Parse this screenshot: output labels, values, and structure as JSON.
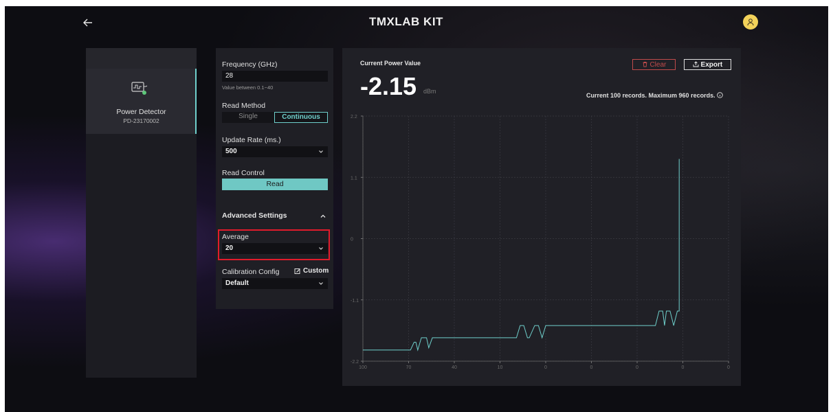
{
  "header": {
    "logo_mark": "T",
    "logo_text": "MXLAB KIT"
  },
  "icons": {
    "back": "arrow-left-icon",
    "avatar": "user-icon",
    "device": "power-detector-icon",
    "chevron": "chevron-down-icon",
    "chevron_up": "chevron-up-icon",
    "edit": "edit-icon",
    "trash": "trash-icon",
    "export": "export-icon",
    "info": "info-icon"
  },
  "colors": {
    "accent": "#6fd0cc",
    "danger": "#c04b4b",
    "avatar": "#f2d25a",
    "highlight": "#e21b2b"
  },
  "device": {
    "name": "Power Detector",
    "id": "PD-23170002",
    "status": "connected"
  },
  "settings": {
    "frequency_label": "Frequency (GHz)",
    "frequency_value": "28",
    "frequency_hint": "Value between 0.1~40",
    "read_method_label": "Read Method",
    "read_method_options": [
      "Single",
      "Continuous"
    ],
    "read_method_selected": "Continuous",
    "update_rate_label": "Update Rate (ms.)",
    "update_rate_value": "500",
    "read_control_label": "Read Control",
    "read_button": "Read",
    "advanced_label": "Advanced Settings",
    "average_label": "Average",
    "average_value": "20",
    "calibration_label": "Calibration Config",
    "custom_label": "Custom",
    "calibration_value": "Default"
  },
  "power": {
    "title": "Current Power Value",
    "value": "-2.15",
    "unit": "dBm",
    "clear_label": "Clear",
    "export_label": "Export",
    "records_text": "Current 100 records. Maximum 960 records."
  },
  "chart_data": {
    "type": "line",
    "y_ticks": [
      "2.2",
      "1.1",
      "0",
      "-1.1",
      "-2.2"
    ],
    "x_ticks": [
      "100",
      "70",
      "40",
      "10",
      "0",
      "0",
      "0",
      "0",
      "0"
    ],
    "ylim": [
      -2.2,
      2.2
    ],
    "xlim": [
      100,
      0
    ],
    "grid": true,
    "series": [
      {
        "color": "#6fd0cc",
        "x": [
          100,
          87,
          86,
          85.5,
          85,
          84,
          82.6,
          82,
          81,
          80,
          58,
          57,
          56,
          55,
          54.5,
          53,
          52,
          51,
          50,
          49,
          49,
          20,
          19,
          18,
          17.5,
          17,
          16,
          15,
          14,
          13.5,
          13.5
        ],
        "y": [
          -2.0,
          -2.0,
          -1.86,
          -1.86,
          -2.0,
          -1.78,
          -1.78,
          -1.96,
          -1.78,
          -1.78,
          -1.78,
          -1.56,
          -1.56,
          -1.78,
          -1.78,
          -1.56,
          -1.56,
          -1.78,
          -1.56,
          -1.56,
          -1.56,
          -1.56,
          -1.3,
          -1.3,
          -1.56,
          -1.3,
          -1.3,
          -1.56,
          -1.3,
          -1.3,
          1.43
        ]
      }
    ]
  }
}
